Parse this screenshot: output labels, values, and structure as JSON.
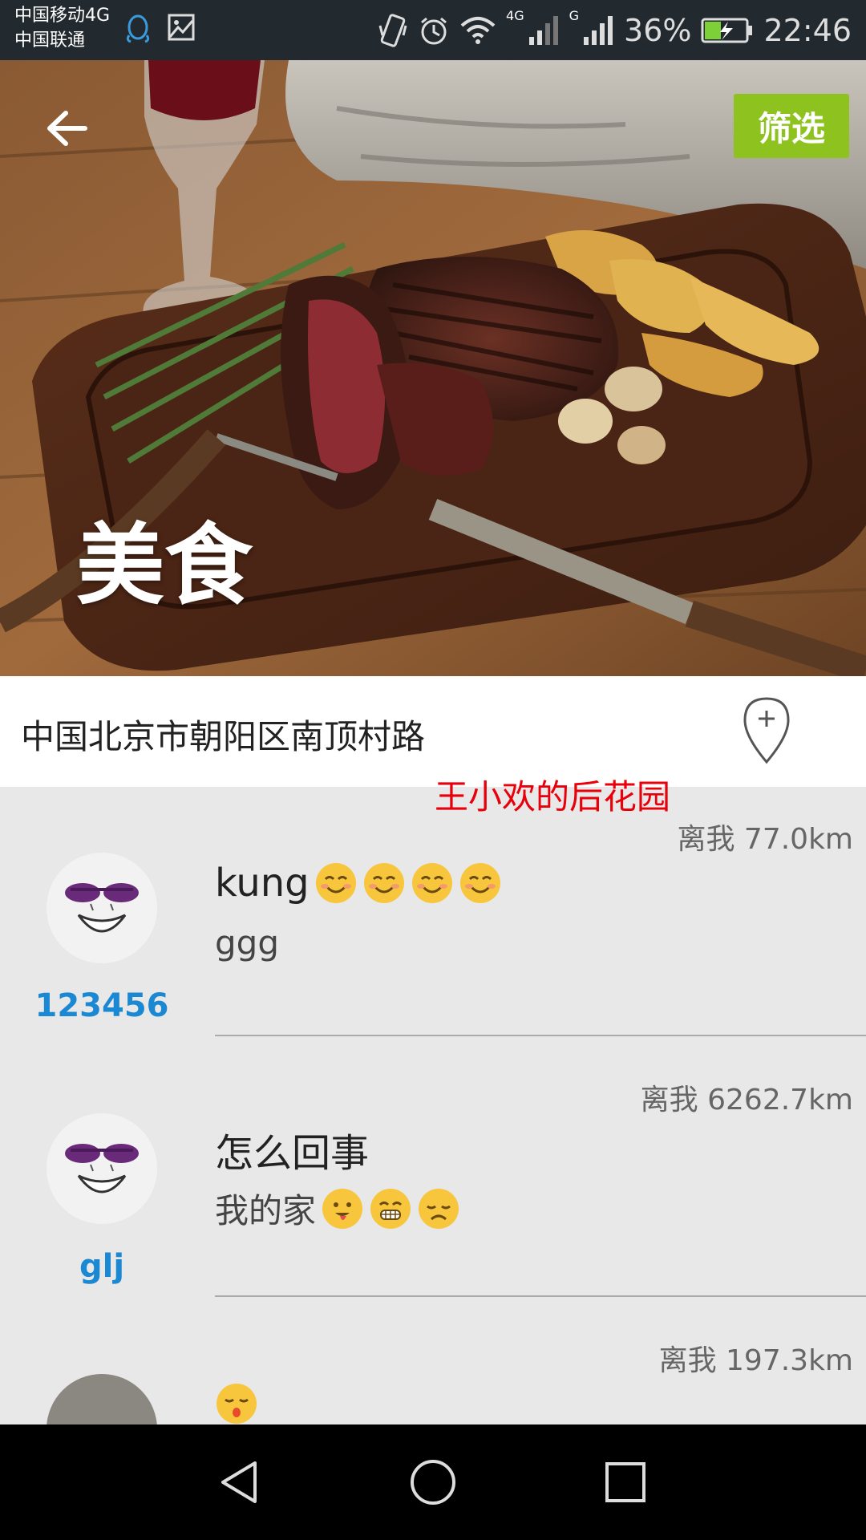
{
  "status_bar": {
    "carrier_1": "中国移动4G",
    "carrier_2": "中国联通",
    "network_1": "4G",
    "network_2": "G",
    "battery": "36%",
    "time": "22:46"
  },
  "header": {
    "back_icon": "arrow-left-icon",
    "filter_label": "筛选",
    "category_title": "美食"
  },
  "location": {
    "address": "中国北京市朝阳区南顶村路",
    "add_icon": "map-pin-plus-icon"
  },
  "garden_title": "王小欢的后花园",
  "feed": [
    {
      "distance": "离我 77.0km",
      "title": "kung",
      "title_emojis": [
        "smiling-face",
        "smiling-face",
        "smiling-face",
        "smiling-face"
      ],
      "body": "ggg",
      "body_emojis": [],
      "username": "123456"
    },
    {
      "distance": "离我 6262.7km",
      "title": "怎么回事",
      "title_emojis": [],
      "body": "我的家",
      "body_emojis": [
        "tongue-face",
        "grinning-face",
        "sad-face"
      ],
      "username": "glj"
    },
    {
      "distance": "离我 197.3km",
      "title": "",
      "title_emojis": [
        "kissing-face"
      ],
      "body": "",
      "body_emojis": [],
      "username": ""
    }
  ],
  "colors": {
    "filter_button": "#8dc21f",
    "username": "#1a88d2",
    "garden_title": "#e8000b",
    "feed_background": "#e8e8e8"
  }
}
